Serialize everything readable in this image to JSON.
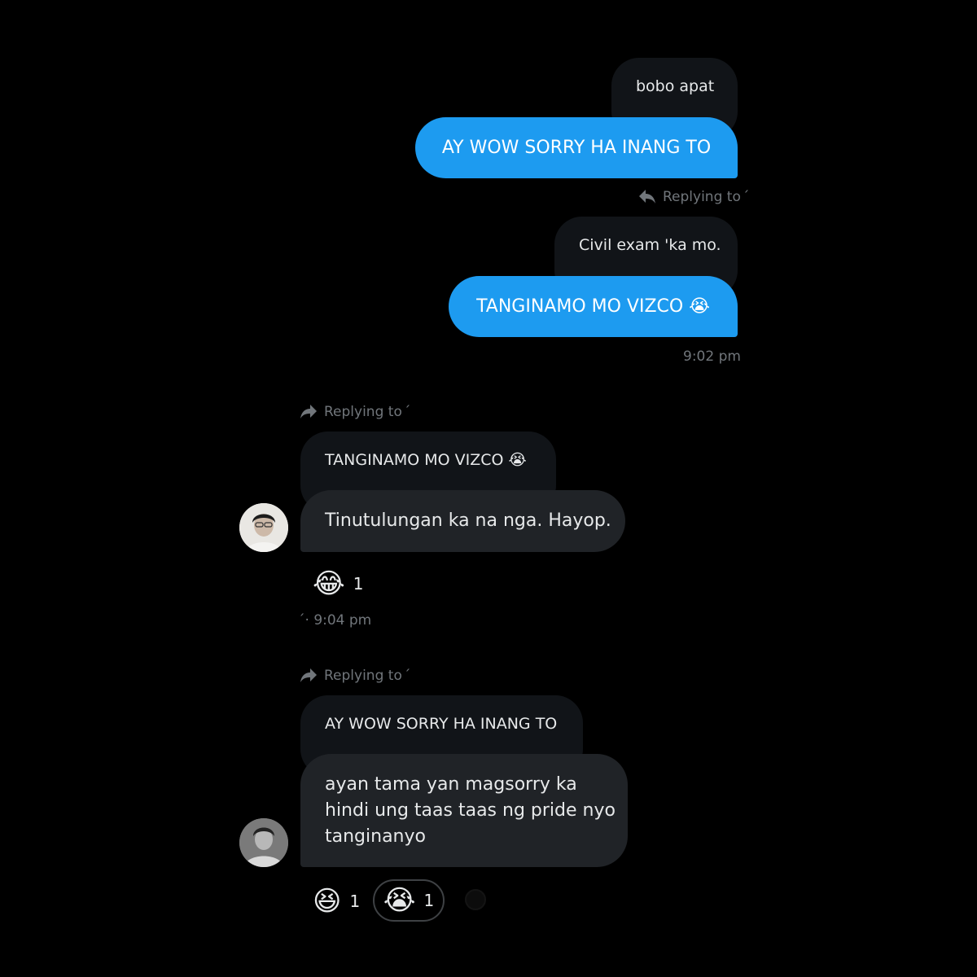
{
  "messages": {
    "sent_group": {
      "quote_1": "bobo apat",
      "bubble_1": "AY WOW SORRY HA INANG TO",
      "reply_label": "Replying to",
      "reply_mark": "ˊ",
      "quote_2": "Civil exam 'ka mo.",
      "bubble_2": "TANGINAMO MO VIZCO 😭",
      "time": "9:02 pm"
    },
    "recv_1": {
      "reply_label": "Replying to",
      "reply_mark": "ˊ",
      "quote": "TANGINAMO MO VIZCO 😭",
      "bubble": "Tinutulungan ka na nga. Hayop.",
      "reaction_emoji": "😂",
      "reaction_count": "1",
      "time_prefix": "ˊ·",
      "time": "9:04 pm"
    },
    "recv_2": {
      "reply_label": "Replying to",
      "reply_mark": "ˊ",
      "quote": "AY WOW SORRY HA INANG TO",
      "bubble_line_1": "ayan tama yan magsorry ka",
      "bubble_line_2": "hindi ung taas taas ng pride nyo",
      "bubble_line_3": "tanginanyo",
      "reactions": [
        {
          "emoji": "😆",
          "count": "1"
        },
        {
          "emoji": "😭",
          "count": "1"
        }
      ]
    }
  },
  "icons": {
    "reply_back": "reply-icon",
    "reply_forward": "forward-arrow-icon"
  },
  "colors": {
    "background": "#000000",
    "sent_bubble": "#1d9bf0",
    "received_bubble": "#202327",
    "quote_bubble": "#111418",
    "meta_text": "#71767b"
  }
}
